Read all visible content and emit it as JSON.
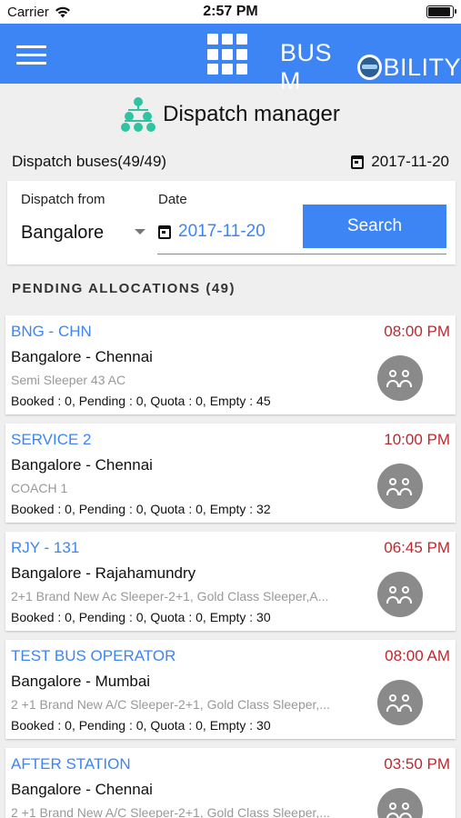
{
  "status_bar": {
    "carrier": "Carrier",
    "time": "2:57 PM"
  },
  "app_bar": {
    "brand_left": "BUS M",
    "brand_right": "BILITY"
  },
  "page": {
    "title": "Dispatch manager"
  },
  "summary": {
    "dispatch_count": "Dispatch buses(49/49)",
    "date": "2017-11-20"
  },
  "filter": {
    "from_label": "Dispatch from",
    "from_value": "Bangalore",
    "date_label": "Date",
    "date_value": "2017-11-20",
    "search_label": "Search"
  },
  "section": {
    "header": "PENDING ALLOCATIONS (49)"
  },
  "allocations": [
    {
      "code": "BNG - CHN",
      "time": "08:00 PM",
      "route": "Bangalore - Chennai",
      "bus_type": "Semi Sleeper 43 AC",
      "stats": "Booked : 0, Pending : 0, Quota : 0, Empty : 45"
    },
    {
      "code": "SERVICE 2",
      "time": "10:00 PM",
      "route": "Bangalore - Chennai",
      "bus_type": "COACH 1",
      "stats": "Booked : 0, Pending : 0, Quota : 0, Empty : 32"
    },
    {
      "code": "RJY - 131",
      "time": "06:45 PM",
      "route": "Bangalore - Rajahamundry",
      "bus_type": "2+1 Brand New Ac Sleeper-2+1, Gold Class Sleeper,A...",
      "stats": "Booked : 0, Pending : 0, Quota : 0, Empty : 30"
    },
    {
      "code": "TEST BUS OPERATOR",
      "time": "08:00 AM",
      "route": "Bangalore - Mumbai",
      "bus_type": "2 +1 Brand New A/C Sleeper-2+1, Gold Class Sleeper,...",
      "stats": "Booked : 0, Pending : 0, Quota : 0, Empty : 30"
    },
    {
      "code": "AFTER STATION",
      "time": "03:50 PM",
      "route": "Bangalore - Chennai",
      "bus_type": "2 +1 Brand New A/C Sleeper-2+1, Gold Class Sleeper,...",
      "stats": ""
    }
  ],
  "colors": {
    "primary": "#3d85f5",
    "time_red": "#c0272d",
    "accent_green": "#2ec4a1",
    "icon_grey": "#8a8a8a"
  },
  "icons": {
    "menu": "hamburger-icon",
    "apps": "grid-icon",
    "title": "org-chart-icon",
    "date": "calendar-icon",
    "group": "people-icon"
  }
}
